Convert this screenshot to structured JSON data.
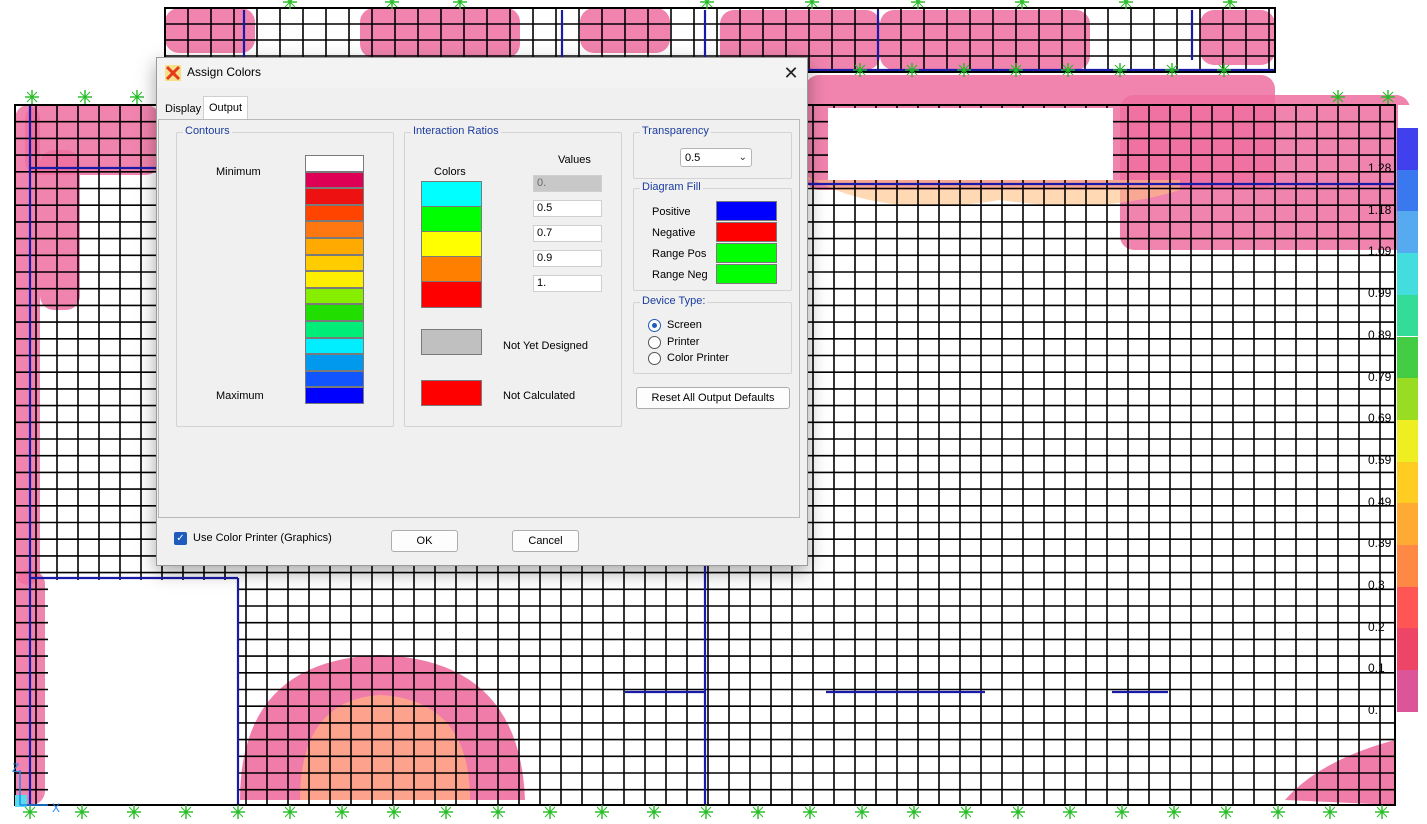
{
  "dialog": {
    "title": "Assign Colors",
    "tabs": [
      "Display",
      "Output"
    ],
    "contours": {
      "title": "Contours",
      "minimum_label": "Minimum",
      "maximum_label": "Maximum",
      "colors": [
        "#ffffff",
        "#dd0055",
        "#ee1111",
        "#ff4400",
        "#ff7711",
        "#ffaa00",
        "#ffcc00",
        "#ffee00",
        "#88ee00",
        "#22dd00",
        "#00ee77",
        "#00eeff",
        "#0099ee",
        "#1155ff",
        "#0000ff"
      ]
    },
    "interaction_ratios": {
      "title": "Interaction Ratios",
      "colors_header": "Colors",
      "values_header": "Values",
      "colors": [
        "#00ffff",
        "#00ff00",
        "#ffff00",
        "#ff8000",
        "#ff0000"
      ],
      "values": [
        "0.",
        "0.5",
        "0.7",
        "0.9",
        "1."
      ],
      "not_yet_designed_label": "Not Yet Designed",
      "not_yet_designed_color": "#c0c0c0",
      "not_calculated_label": "Not Calculated",
      "not_calculated_color": "#ff0000"
    },
    "transparency": {
      "title": "Transparency",
      "value": "0.5"
    },
    "diagram_fill": {
      "title": "Diagram Fill",
      "items": [
        {
          "label": "Positive",
          "color": "#0000ff"
        },
        {
          "label": "Negative",
          "color": "#ff0000"
        },
        {
          "label": "Range Pos",
          "color": "#00ff00"
        },
        {
          "label": "Range Neg",
          "color": "#00ff00"
        }
      ]
    },
    "device_type": {
      "title": "Device Type:",
      "options": [
        "Screen",
        "Printer",
        "Color  Printer"
      ],
      "selected": "Screen"
    },
    "reset_button": "Reset All Output Defaults",
    "use_color_printer": "Use Color Printer (Graphics)",
    "use_color_printer_checked": true,
    "ok": "OK",
    "cancel": "Cancel"
  },
  "legend": {
    "values": [
      "1.28",
      "1.18",
      "1.09",
      "0.99",
      "0.89",
      "0.79",
      "0.69",
      "0.59",
      "0.49",
      "0.39",
      "0.3",
      "0.2",
      "0.1",
      "0."
    ],
    "colors": [
      "#4040ee",
      "#3a78f0",
      "#55aaf0",
      "#44dddd",
      "#33dd99",
      "#44cc44",
      "#99dd22",
      "#eeee22",
      "#ffcc22",
      "#ffaa33",
      "#ff8844",
      "#ff5555",
      "#ee4466",
      "#dd5599",
      "#ffffff"
    ]
  },
  "axis": {
    "x": "X",
    "z": "Z"
  }
}
